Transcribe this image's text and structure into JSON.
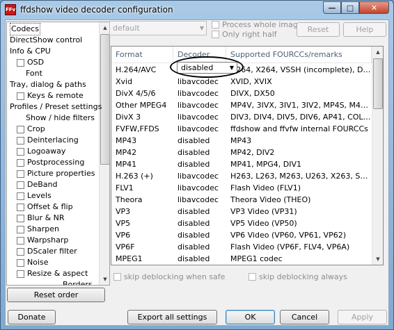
{
  "window": {
    "icon": "FFv",
    "title": "ffdshow video decoder configuration",
    "controls": {
      "minimize": "—",
      "maximize": "□",
      "close": "✕"
    }
  },
  "tree": {
    "items": [
      {
        "label": "Codecs",
        "checkbox": false,
        "indent": 0,
        "selected": true
      },
      {
        "label": "DirectShow control",
        "checkbox": false,
        "indent": 0
      },
      {
        "label": "Info & CPU",
        "checkbox": false,
        "indent": 0
      },
      {
        "label": "OSD",
        "checkbox": true,
        "indent": 1
      },
      {
        "label": "Font",
        "checkbox": false,
        "indent": 2
      },
      {
        "label": "Tray, dialog & paths",
        "checkbox": false,
        "indent": 0
      },
      {
        "label": "Keys & remote",
        "checkbox": true,
        "indent": 1
      },
      {
        "label": "Profiles / Preset settings",
        "checkbox": false,
        "indent": 0
      },
      {
        "label": "Show / hide filters",
        "checkbox": false,
        "indent": 2
      },
      {
        "label": "Crop",
        "checkbox": true,
        "indent": 1
      },
      {
        "label": "Deinterlacing",
        "checkbox": true,
        "indent": 1
      },
      {
        "label": "Logoaway",
        "checkbox": true,
        "indent": 1
      },
      {
        "label": "Postprocessing",
        "checkbox": true,
        "indent": 1
      },
      {
        "label": "Picture properties",
        "checkbox": true,
        "indent": 1
      },
      {
        "label": "DeBand",
        "checkbox": true,
        "indent": 1
      },
      {
        "label": "Levels",
        "checkbox": true,
        "indent": 1
      },
      {
        "label": "Offset & flip",
        "checkbox": true,
        "indent": 1
      },
      {
        "label": "Blur & NR",
        "checkbox": true,
        "indent": 1
      },
      {
        "label": "Sharpen",
        "checkbox": true,
        "indent": 1
      },
      {
        "label": "Warpsharp",
        "checkbox": true,
        "indent": 1
      },
      {
        "label": "DScaler filter",
        "checkbox": true,
        "indent": 1
      },
      {
        "label": "Noise",
        "checkbox": true,
        "indent": 1
      },
      {
        "label": "Resize & aspect",
        "checkbox": true,
        "indent": 1
      },
      {
        "label": "Borders",
        "checkbox": false,
        "indent": 3
      }
    ]
  },
  "top": {
    "preset_value": "default",
    "process_whole_image": "Process whole image",
    "only_right_half": "Only right half",
    "reset_label": "Reset",
    "help_label": "Help"
  },
  "list": {
    "columns": [
      "Format",
      "Decoder",
      "Supported FOURCCs/remarks"
    ],
    "rows": [
      [
        "H.264/AVC",
        "disabled",
        "H264, X264, VSSH (incomplete), DAV..."
      ],
      [
        "Xvid",
        "libavcodec",
        "XVID, XVIX"
      ],
      [
        "DivX 4/5/6",
        "libavcodec",
        "DIVX, DX50"
      ],
      [
        "Other MPEG4",
        "libavcodec",
        "MP4V, 3IVX, 3IV1, 3IV2, MP4S, M4S..."
      ],
      [
        "DivX 3",
        "libavcodec",
        "DIV3, DIV4, DIV5, DIV6, AP41, COL1..."
      ],
      [
        "FVFW,FFDS",
        "libavcodec",
        "ffdshow and ffvfw internal FOURCCs"
      ],
      [
        "MP43",
        "disabled",
        "MP43"
      ],
      [
        "MP42",
        "disabled",
        "MP42, DIV2"
      ],
      [
        "MP41",
        "disabled",
        "MP41, MPG4, DIV1"
      ],
      [
        "H.263 (+)",
        "libavcodec",
        "H263, L263, M263, U263, X263, S26..."
      ],
      [
        "FLV1",
        "libavcodec",
        "Flash Video (FLV1)"
      ],
      [
        "Theora",
        "libavcodec",
        "Theora Video (THEO)"
      ],
      [
        "VP3",
        "disabled",
        "VP3 Video (VP31)"
      ],
      [
        "VP5",
        "disabled",
        "VP5 Video (VP50)"
      ],
      [
        "VP6",
        "disabled",
        "VP6 Video (VP60, VP61, VP62)"
      ],
      [
        "VP6F",
        "disabled",
        "Flash Video (VP6F, FLV4, VP6A)"
      ],
      [
        "MPEG1",
        "disabled",
        "MPEG1 codec"
      ]
    ],
    "editing_decoder_value": "disabled"
  },
  "options": {
    "skip_deblocking_safe": "skip deblocking when safe",
    "skip_deblocking_always": "skip deblocking always"
  },
  "buttons": {
    "reset_order": "Reset order",
    "donate": "Donate",
    "export": "Export all settings",
    "ok": "OK",
    "cancel": "Cancel",
    "apply": "Apply"
  },
  "icons": {
    "dropdown": "▼",
    "scroll_up": "▲",
    "scroll_down": "▼"
  }
}
